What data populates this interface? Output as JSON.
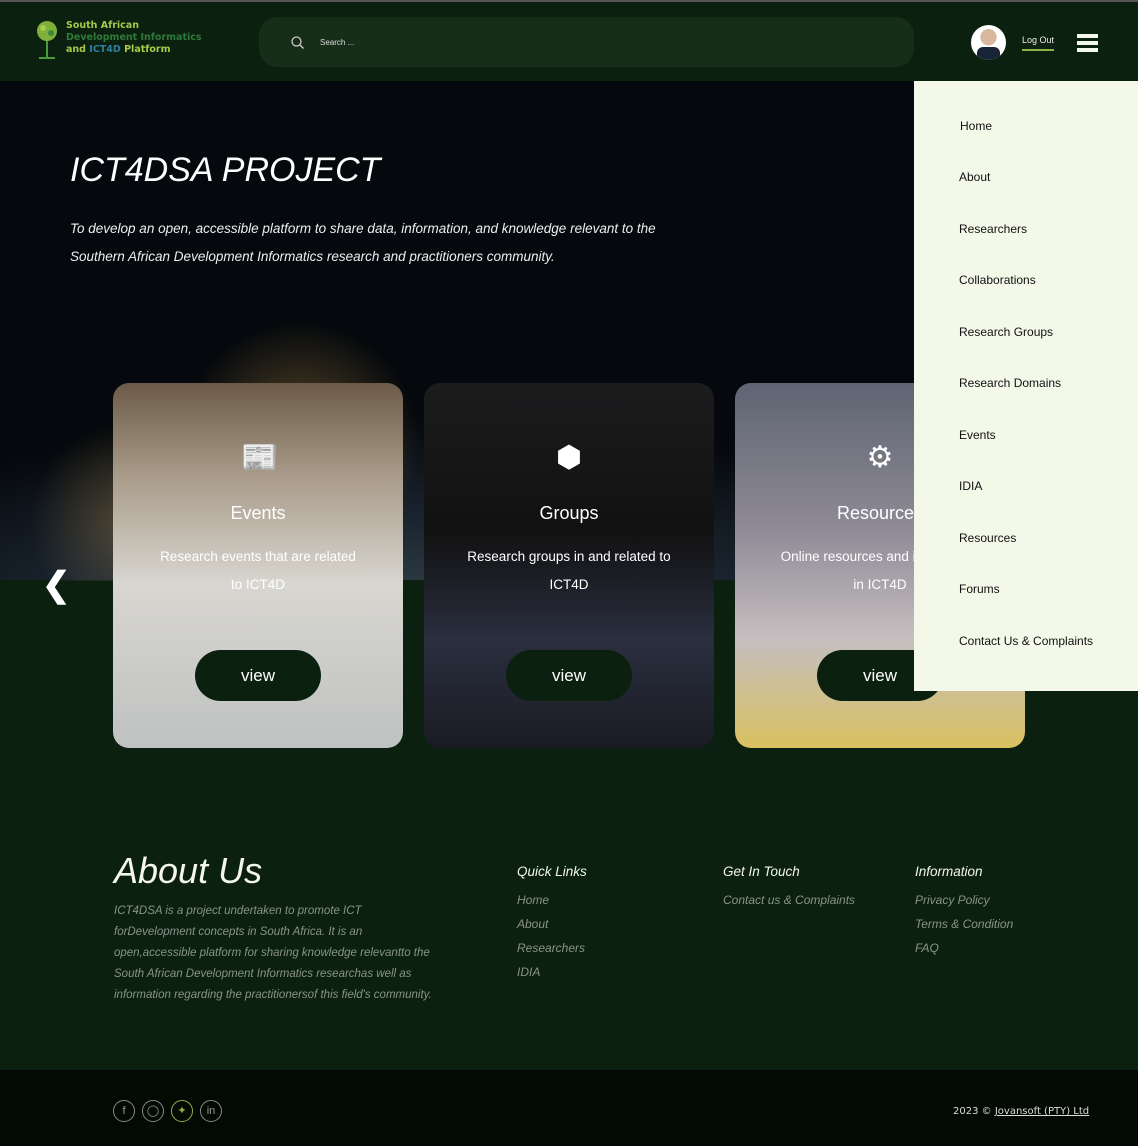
{
  "header": {
    "logo_line1": "South African",
    "logo_line2": "Development Informatics",
    "logo_line3a": "and",
    "logo_line3b": "ICT4D",
    "logo_line3c": "Platform",
    "search_placeholder": "Search ...",
    "logout": "Log Out"
  },
  "hero": {
    "title": "ICT4DSA PROJECT",
    "subtitle": "To develop an open, accessible platform to share data, information, and knowledge relevant to the Southern African Development Informatics research and practitioners community."
  },
  "cards": [
    {
      "title": "Events",
      "desc": "Research events that are related to ICT4D",
      "button": "view"
    },
    {
      "title": "Groups",
      "desc": "Research groups in and related to ICT4D",
      "button": "view"
    },
    {
      "title": "Resources",
      "desc": "Online resources and information in ICT4D",
      "button": "view"
    }
  ],
  "menu": [
    "Home",
    "About",
    "Researchers",
    "Collaborations",
    "Research Groups",
    "Research Domains",
    "Events",
    "IDIA",
    "Resources",
    "Forums",
    "Contact Us & Complaints"
  ],
  "about": {
    "title": "About Us",
    "text": "ICT4DSA is a project undertaken to promote ICT forDevelopment concepts in South Africa. It is an open,accessible platform for sharing knowledge relevantto the South African Development Informatics researchas well as information regarding the practitionersof this field's community."
  },
  "footer": {
    "quick_links": {
      "title": "Quick Links",
      "items": [
        "Home",
        "About",
        "Researchers",
        "IDIA"
      ]
    },
    "get_in_touch": {
      "title": "Get In Touch",
      "items": [
        "Contact us & Complaints"
      ]
    },
    "information": {
      "title": "Information",
      "items": [
        "Privacy Policy",
        "Terms & Condition",
        "FAQ"
      ]
    },
    "copyright": "2023 ©",
    "company": "Jovansoft (PTY) Ltd"
  },
  "colors": {
    "bg": "#0b200e",
    "accent": "#8cb24a",
    "menu_bg": "#f3f8e8"
  }
}
